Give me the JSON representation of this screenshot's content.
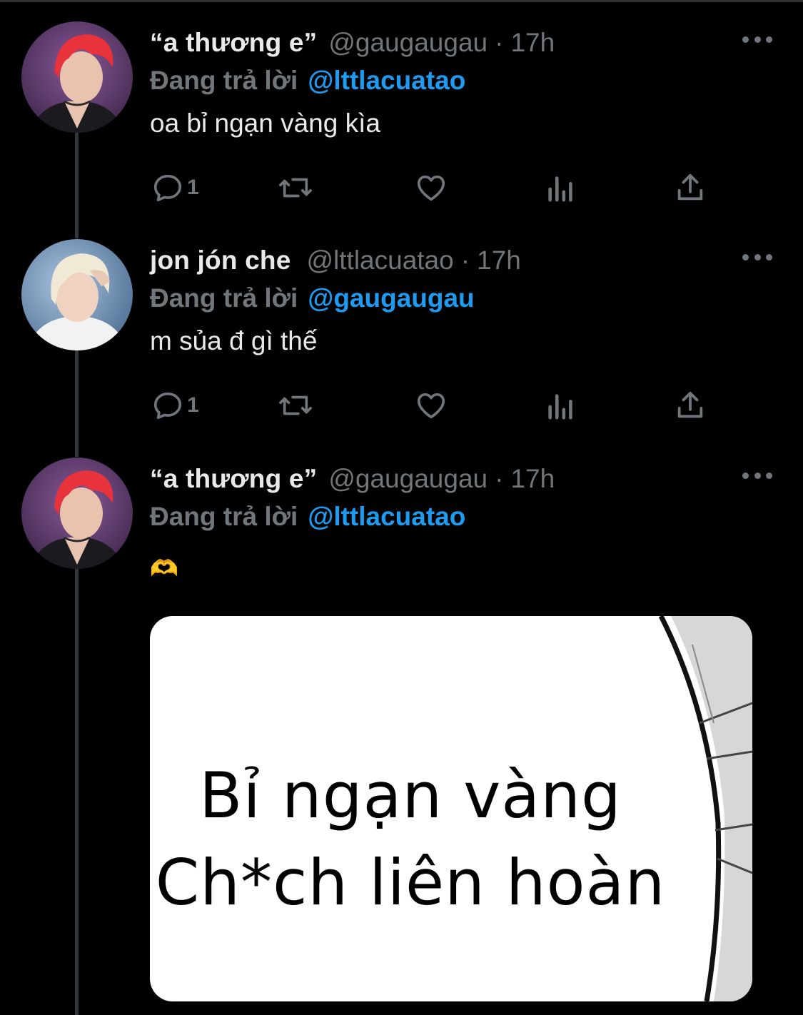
{
  "tweets": [
    {
      "display_name": "“a thương e”",
      "handle": "@gaugaugau",
      "separator": "·",
      "time": "17h",
      "reply_label": "Đang trả lời",
      "reply_handle": "@lttlacuatao",
      "text": "oa bỉ ngạn vàng kìa",
      "reply_count": "1",
      "avatar": "red-hair-avatar"
    },
    {
      "display_name": "jon jón che",
      "handle": "@lttlacuatao",
      "separator": "·",
      "time": "17h",
      "reply_label": "Đang trả lời",
      "reply_handle": "@gaugaugau",
      "text": "m sủa đ gì thế",
      "reply_count": "1",
      "avatar": "blonde-hair-avatar"
    },
    {
      "display_name": "“a thương e”",
      "handle": "@gaugaugau",
      "separator": "·",
      "time": "17h",
      "reply_label": "Đang trả lời",
      "reply_handle": "@lttlacuatao",
      "text": "🫶",
      "avatar": "red-hair-avatar",
      "media": {
        "line1": "Bỉ ngạn vàng",
        "line2": "Ch*ch liên hoàn"
      }
    }
  ],
  "icons": [
    "reply-icon",
    "retweet-icon",
    "like-icon",
    "views-icon",
    "share-icon",
    "more-icon"
  ],
  "colors": {
    "background": "#000000",
    "text": "#e7e9ea",
    "muted": "#71767b",
    "link": "#1d9bf0",
    "thread": "#333639"
  }
}
